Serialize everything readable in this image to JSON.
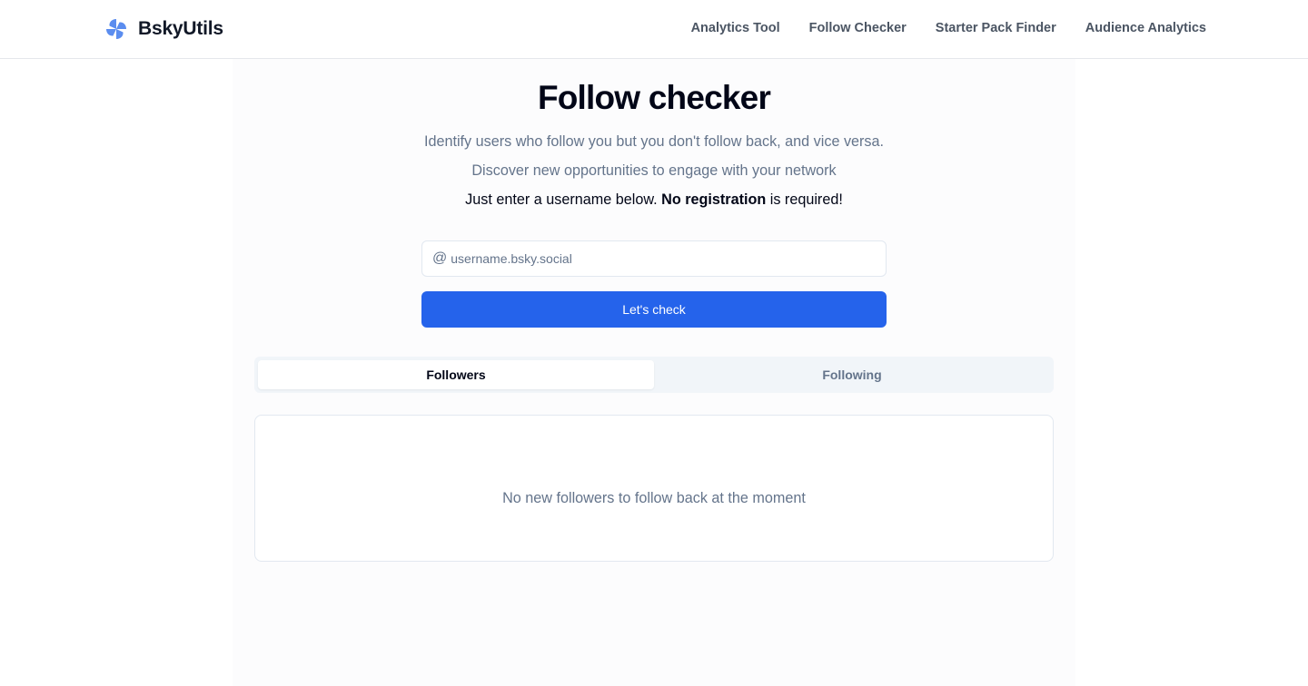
{
  "nav": {
    "brand_name": "BskyUtils",
    "brand_logo_icon": "pinwheel-icon",
    "brand_color": "#5b8def",
    "links": [
      {
        "label": "Analytics Tool"
      },
      {
        "label": "Follow Checker"
      },
      {
        "label": "Starter Pack Finder"
      },
      {
        "label": "Audience Analytics"
      }
    ]
  },
  "hero": {
    "title": "Follow checker",
    "subtitle_1": "Identify users who follow you but you don't follow back, and vice versa.",
    "subtitle_2": "Discover new opportunities to engage with your network",
    "note_prefix": "Just enter a username below. ",
    "note_bold": "No registration",
    "note_suffix": " is required!"
  },
  "search": {
    "prefix": "@",
    "placeholder": "username.bsky.social",
    "value": "",
    "button_label": "Let's check",
    "button_color": "#2563eb"
  },
  "tabs": [
    {
      "label": "Followers",
      "active": true
    },
    {
      "label": "Following",
      "active": false
    }
  ],
  "results": {
    "empty_message": "No new followers to follow back at the moment"
  }
}
